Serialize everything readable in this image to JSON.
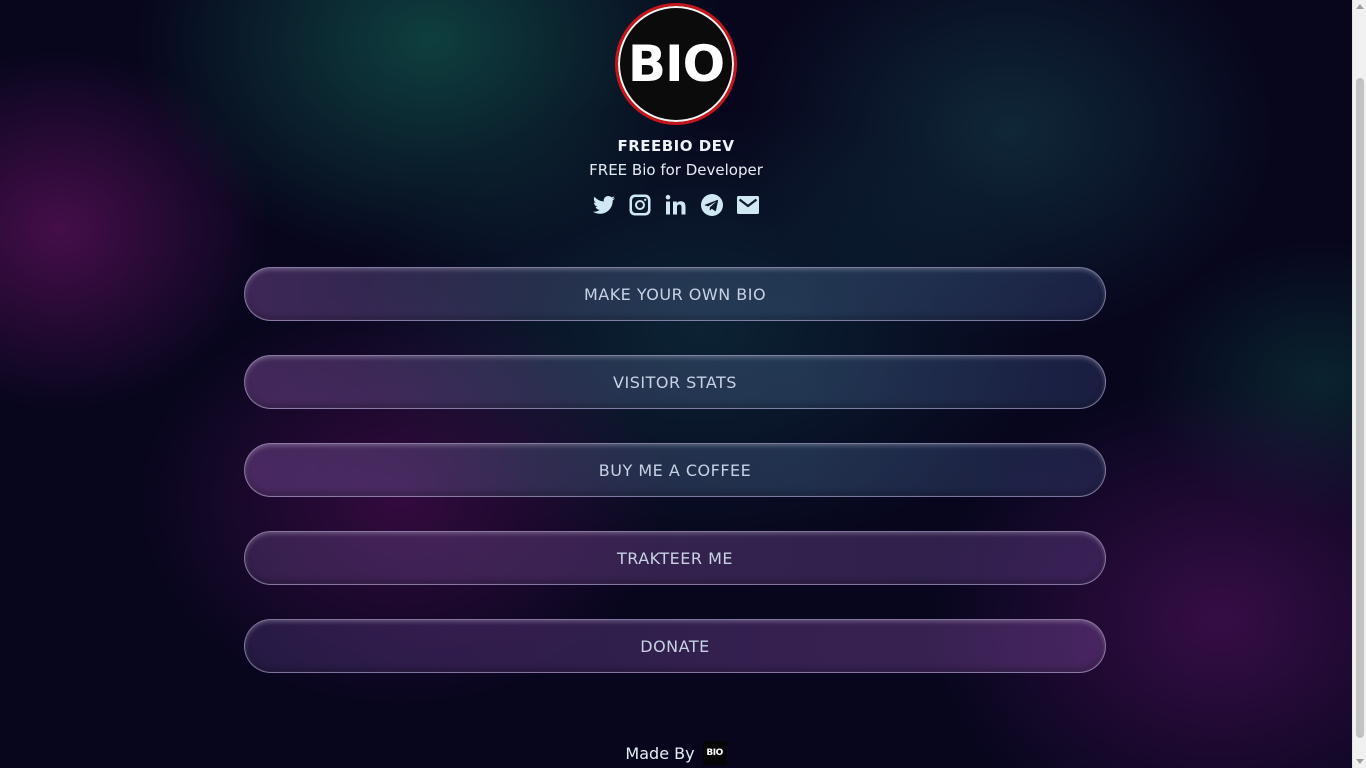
{
  "profile": {
    "avatar_text": "BIO",
    "name": "FREEBIO DEV",
    "tagline": "FREE Bio for Developer"
  },
  "socials": [
    {
      "icon": "twitter-icon"
    },
    {
      "icon": "instagram-icon"
    },
    {
      "icon": "linkedin-icon"
    },
    {
      "icon": "telegram-icon"
    },
    {
      "icon": "email-icon"
    }
  ],
  "links": [
    {
      "label": "MAKE YOUR OWN BIO"
    },
    {
      "label": "VISITOR STATS"
    },
    {
      "label": "BUY ME A COFFEE"
    },
    {
      "label": "TRAKTEER ME"
    },
    {
      "label": "DONATE"
    }
  ],
  "footer": {
    "made_by": "Made By",
    "logo_text": "BIO"
  },
  "colors": {
    "background": "#07061d",
    "avatar_border": "#c3161c",
    "icon_color": "#cfe8f4"
  }
}
